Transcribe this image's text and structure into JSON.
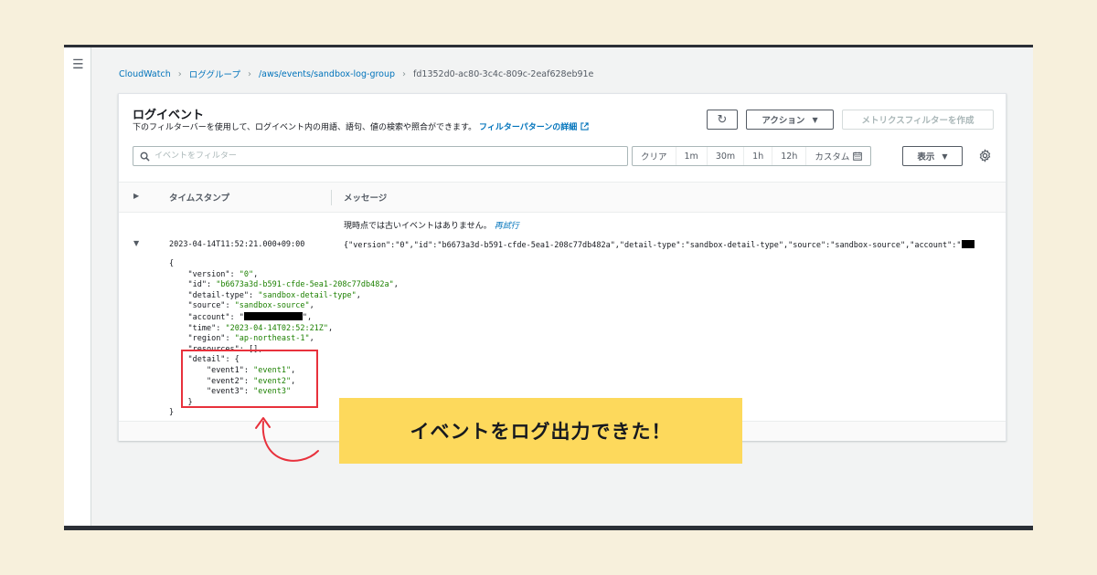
{
  "breadcrumb": {
    "items": [
      "CloudWatch",
      "ロググループ",
      "/aws/events/sandbox-log-group"
    ],
    "current": "fd1352d0-ac80-3c4c-809c-2eaf628eb91e"
  },
  "panel": {
    "title": "ログイベント",
    "description": "下のフィルターバーを使用して、ログイベント内の用語、語句、値の検索や照合ができます。",
    "description_link": "フィルターパターンの詳細",
    "actions_label": "アクション",
    "metric_filter_label": "メトリクスフィルターを作成",
    "refresh_icon": "refresh-icon"
  },
  "filter": {
    "placeholder": "イベントをフィルター",
    "ranges": [
      "クリア",
      "1m",
      "30m",
      "1h",
      "12h",
      "カスタム"
    ],
    "view_label": "表示"
  },
  "table": {
    "headers": {
      "timestamp": "タイムスタンプ",
      "message": "メッセージ"
    },
    "notice": "現時点では古いイベントはありません。",
    "retry": "再試行",
    "event": {
      "timestamp": "2023-04-14T11:52:21.000+09:00",
      "message": "{\"version\":\"0\",\"id\":\"b6673a3d-b591-cfde-5ea1-208c77db482a\",\"detail-type\":\"sandbox-detail-type\",\"source\":\"sandbox-source\",\"account\":\""
    }
  },
  "json": {
    "open": "{",
    "close": "}",
    "version_key": "\"version\"",
    "version_val": "\"0\"",
    "id_key": "\"id\"",
    "id_val": "\"b6673a3d-b591-cfde-5ea1-208c77db482a\"",
    "detail_type_key": "\"detail-type\"",
    "detail_type_val": "\"sandbox-detail-type\"",
    "source_key": "\"source\"",
    "source_val": "\"sandbox-source\"",
    "account_key": "\"account\"",
    "time_key": "\"time\"",
    "time_val": "\"2023-04-14T02:52:21Z\"",
    "region_key": "\"region\"",
    "region_val": "\"ap-northeast-1\"",
    "resources_key": "\"resources\"",
    "resources_val": "[]",
    "detail_key": "\"detail\"",
    "event1_key": "\"event1\"",
    "event1_val": "\"event1\"",
    "event2_key": "\"event2\"",
    "event2_val": "\"event2\"",
    "event3_key": "\"event3\"",
    "event3_val": "\"event3\""
  },
  "callout": {
    "text": "イベントをログ出力できた！"
  },
  "colors": {
    "background": "#f7f0dc",
    "callout": "#fdd95c",
    "highlight": "#e8313c",
    "link": "#0073bb",
    "json_value": "#1d8102"
  }
}
